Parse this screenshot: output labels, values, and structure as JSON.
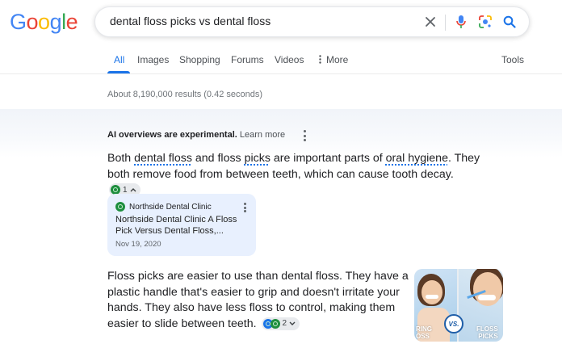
{
  "logo": {
    "letters": [
      "G",
      "o",
      "o",
      "g",
      "l",
      "e"
    ],
    "colors": [
      "#4285f4",
      "#ea4335",
      "#fbbc05",
      "#4285f4",
      "#34a853",
      "#ea4335"
    ]
  },
  "search": {
    "query": "dental floss picks vs dental floss"
  },
  "tabs": [
    {
      "label": "All",
      "active": true
    },
    {
      "label": "Images"
    },
    {
      "label": "Shopping"
    },
    {
      "label": "Forums"
    },
    {
      "label": "Videos"
    },
    {
      "label": "More"
    },
    {
      "label": "Tools"
    }
  ],
  "stats": "About 8,190,000 results (0.42 seconds)",
  "ai": {
    "header_bold": "AI overviews are experimental.",
    "learn_more": "Learn more",
    "p1": {
      "t1": "Both ",
      "link1": "dental floss",
      "t2": " and floss ",
      "link2": "picks",
      "t3": " are important parts of ",
      "link3": "oral hygiene",
      "t4": ". They both remove food from between teeth, which can cause tooth decay.",
      "chip_count": "1"
    },
    "source": {
      "site": "Northside Dental Clinic",
      "title": "Northside Dental Clinic A Floss Pick Versus Dental Floss,...",
      "date": "Nov 19, 2020"
    },
    "p2": {
      "text": "Floss picks are easier to use than dental floss. They have a plastic handle that's easier to grip and doesn't irritate your hands. They also have less floss to control, making them easier to slide between teeth.",
      "chip_count": "2"
    },
    "thumb": {
      "vs": "VS.",
      "left_label": "RING\nOSS",
      "right_label": "FLOSS\nPICKS"
    }
  }
}
